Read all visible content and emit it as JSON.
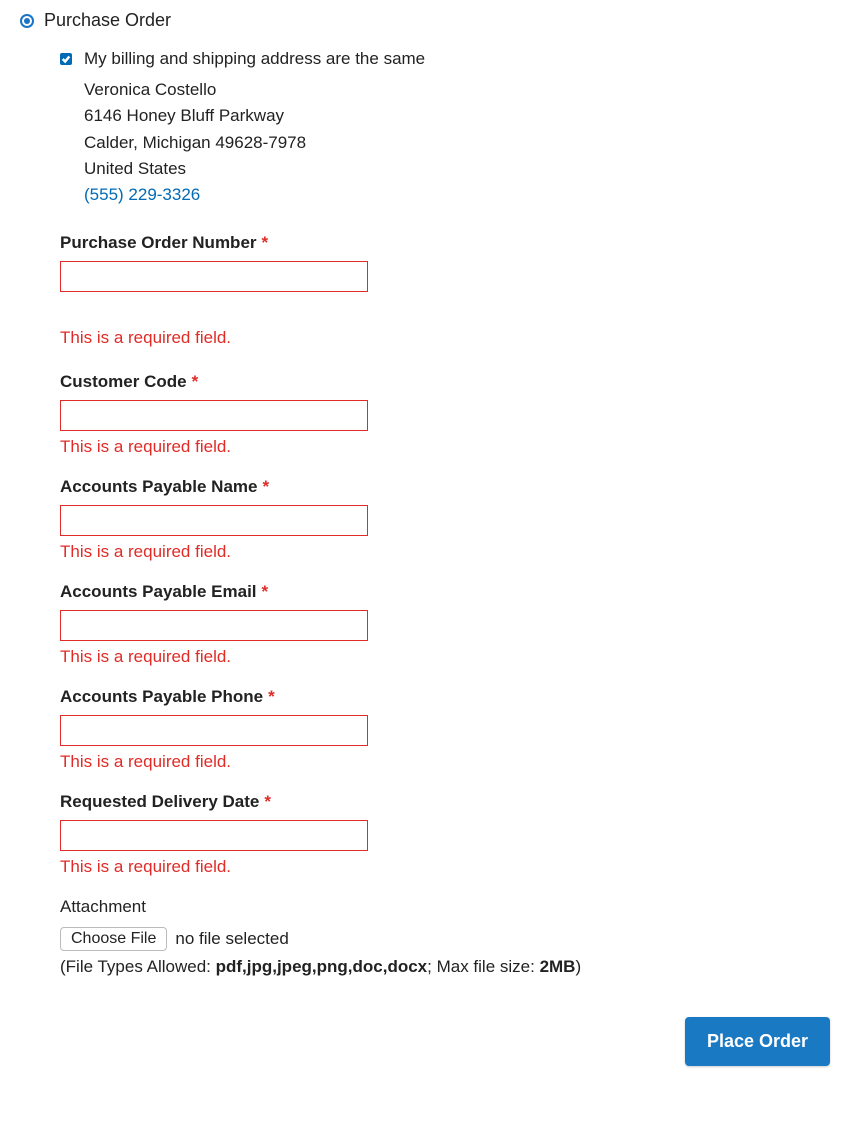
{
  "payment": {
    "method_label": "Purchase Order",
    "same_address_label": "My billing and shipping address are the same"
  },
  "address": {
    "name": "Veronica Costello",
    "street": "6146 Honey Bluff Parkway",
    "city_state_zip": "Calder, Michigan 49628-7978",
    "country": "United States",
    "phone": "(555) 229-3326"
  },
  "errors": {
    "required": "This is a required field."
  },
  "fields": {
    "po_number": {
      "label": "Purchase Order Number",
      "value": ""
    },
    "customer_code": {
      "label": "Customer Code",
      "value": ""
    },
    "ap_name": {
      "label": "Accounts Payable Name",
      "value": ""
    },
    "ap_email": {
      "label": "Accounts Payable Email",
      "value": ""
    },
    "ap_phone": {
      "label": "Accounts Payable Phone",
      "value": ""
    },
    "delivery_date": {
      "label": "Requested Delivery Date",
      "value": ""
    },
    "attachment": {
      "label": "Attachment",
      "button": "Choose File",
      "status": "no file selected",
      "note_prefix": "(File Types Allowed: ",
      "note_types": "pdf,jpg,jpeg,png,doc,docx",
      "note_mid": "; Max file size: ",
      "note_size": "2MB",
      "note_suffix": ")"
    }
  },
  "actions": {
    "place_order": "Place Order"
  },
  "required_marker": "*"
}
